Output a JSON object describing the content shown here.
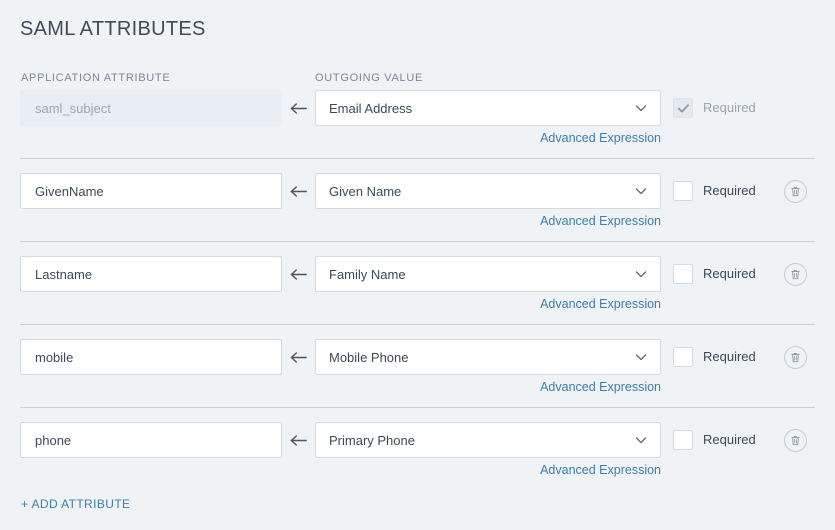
{
  "page": {
    "title": "SAML ATTRIBUTES",
    "accent_color": "#3b7fab",
    "background_color": "#eff3f6",
    "text_color": "#3c4a57",
    "muted_text_color": "#9aa5b1"
  },
  "columns": {
    "application_attribute": "APPLICATION ATTRIBUTE",
    "outgoing_value": "OUTGOING VALUE"
  },
  "labels": {
    "required": "Required",
    "advanced_expression": "Advanced Expression",
    "add_attribute": "+ ADD ATTRIBUTE",
    "arrow_glyph": "←"
  },
  "rows": [
    {
      "attribute_value": "",
      "attribute_placeholder": "saml_subject",
      "attribute_disabled": true,
      "outgoing_value": "Email Address",
      "required_checked": true,
      "required_disabled": true,
      "deletable": false,
      "advanced_expression": "Advanced Expression",
      "divider_below": true
    },
    {
      "attribute_value": "GivenName",
      "attribute_placeholder": "",
      "attribute_disabled": false,
      "outgoing_value": "Given Name",
      "required_checked": false,
      "required_disabled": false,
      "deletable": true,
      "advanced_expression": "Advanced Expression",
      "divider_below": true
    },
    {
      "attribute_value": "Lastname",
      "attribute_placeholder": "",
      "attribute_disabled": false,
      "outgoing_value": "Family Name",
      "required_checked": false,
      "required_disabled": false,
      "deletable": true,
      "advanced_expression": "Advanced Expression",
      "divider_below": true
    },
    {
      "attribute_value": "mobile",
      "attribute_placeholder": "",
      "attribute_disabled": false,
      "outgoing_value": "Mobile Phone",
      "required_checked": false,
      "required_disabled": false,
      "deletable": true,
      "advanced_expression": "Advanced Expression",
      "divider_below": true
    },
    {
      "attribute_value": "phone",
      "attribute_placeholder": "",
      "attribute_disabled": false,
      "outgoing_value": "Primary Phone",
      "required_checked": false,
      "required_disabled": false,
      "deletable": true,
      "advanced_expression": "Advanced Expression",
      "divider_below": false
    }
  ]
}
